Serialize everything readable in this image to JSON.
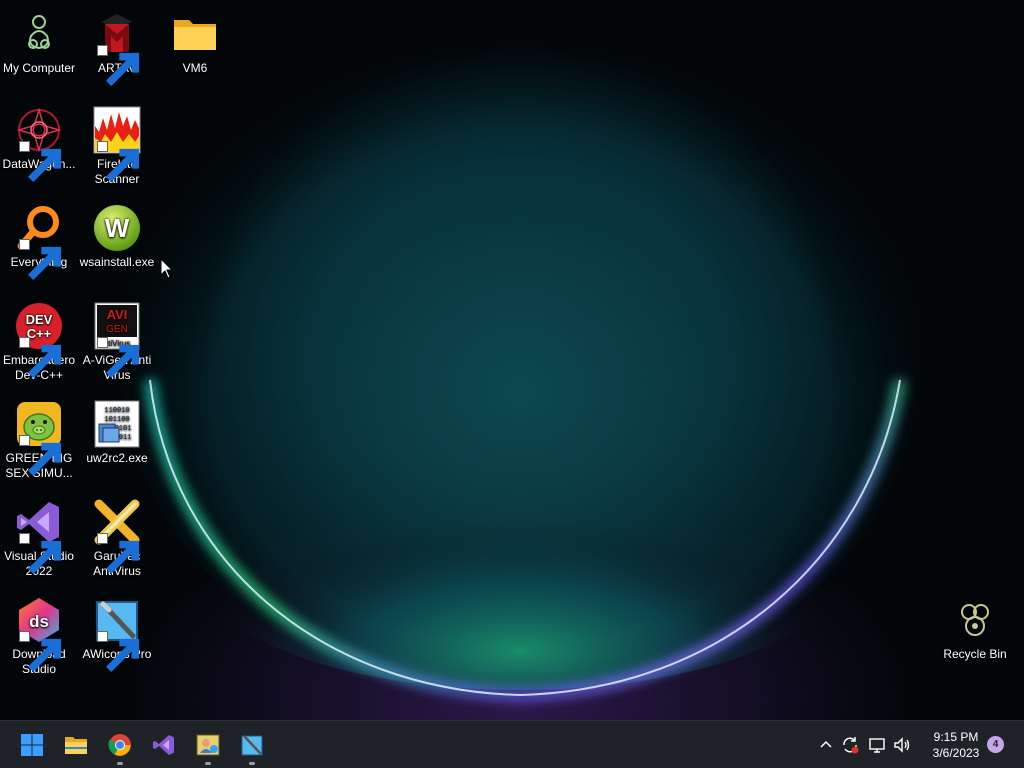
{
  "desktop": {
    "icons": [
      {
        "label": "My Computer"
      },
      {
        "label": "ARTAV"
      },
      {
        "label": "VM6"
      },
      {
        "label": "DataWagon..."
      },
      {
        "label": "FireLite Scanner"
      },
      {
        "label": "Everything"
      },
      {
        "label": "wsainstall.exe"
      },
      {
        "label": "Embarcadero Dev-C++"
      },
      {
        "label": "A-ViGen Anti Virus"
      },
      {
        "label": "GREEN PIG SEX SIMU..."
      },
      {
        "label": "uw2rc2.exe"
      },
      {
        "label": "Visual Studio 2022"
      },
      {
        "label": "GaruYac AntiVirus"
      },
      {
        "label": "Download Studio"
      },
      {
        "label": "AWicons Pro"
      },
      {
        "label": "Recycle Bin"
      }
    ],
    "icon_text": {
      "devcpp": "DEV C++",
      "avigen_top": "AVI",
      "avigen_mid": "GEN",
      "avigen_bottom": "ntiVirus",
      "binary": "110010 101100 0101 0011",
      "wsa": "W",
      "ds": "ds"
    }
  },
  "taskbar": {
    "apps": [
      {
        "name": "start-icon"
      },
      {
        "name": "file-explorer-icon"
      },
      {
        "name": "chrome-icon"
      },
      {
        "name": "visual-studio-icon"
      },
      {
        "name": "app-icon"
      },
      {
        "name": "awicons-icon"
      }
    ],
    "tray": {
      "time": "9:15 PM",
      "date": "3/6/2023",
      "notifications": "4"
    }
  },
  "colors": {
    "taskbar": "#1f2328",
    "accent": "#3aa0ff"
  }
}
